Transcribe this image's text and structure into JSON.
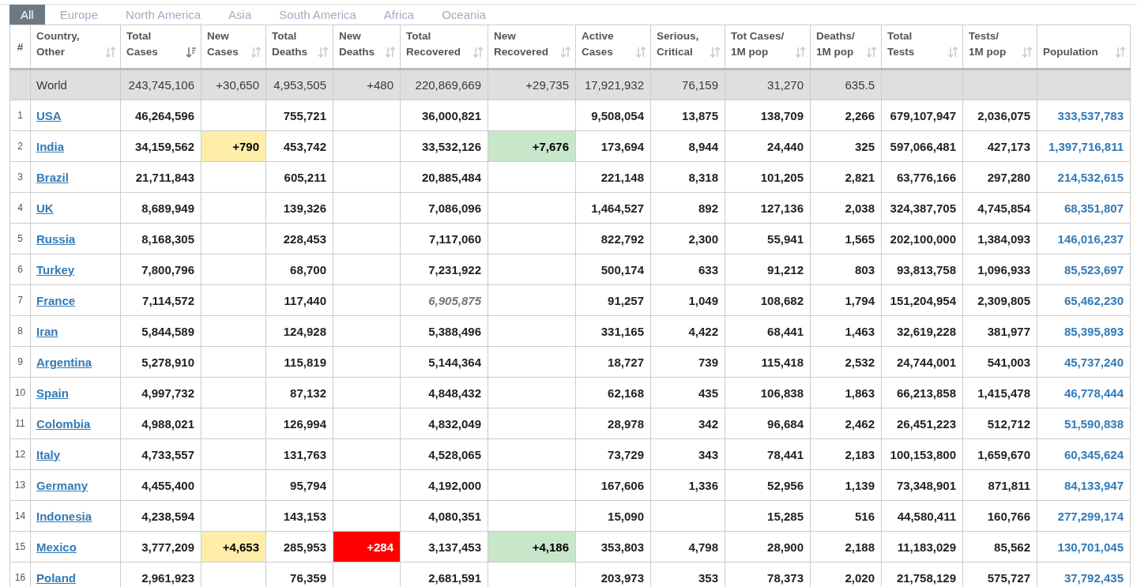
{
  "tabs": [
    {
      "label": "All",
      "selected": true
    },
    {
      "label": "Europe",
      "selected": false
    },
    {
      "label": "North America",
      "selected": false
    },
    {
      "label": "Asia",
      "selected": false
    },
    {
      "label": "South America",
      "selected": false
    },
    {
      "label": "Africa",
      "selected": false
    },
    {
      "label": "Oceania",
      "selected": false
    }
  ],
  "table": {
    "rank_header": "#",
    "country_header": {
      "label": [
        "Country,",
        "Other"
      ],
      "sorted": false
    },
    "columns": [
      {
        "label": [
          "Total",
          "Cases"
        ],
        "kind": "number",
        "sorted": true
      },
      {
        "label": [
          "New",
          "Cases"
        ],
        "kind": "new_cases",
        "sorted": false,
        "color": "#ffeeaa"
      },
      {
        "label": [
          "Total",
          "Deaths"
        ],
        "kind": "number",
        "sorted": false
      },
      {
        "label": [
          "New",
          "Deaths"
        ],
        "kind": "new_deaths",
        "sorted": false,
        "color": "#ff0000"
      },
      {
        "label": [
          "Total",
          "Recovered"
        ],
        "kind": "number",
        "sorted": false
      },
      {
        "label": [
          "New",
          "Recovered"
        ],
        "kind": "new_recovered",
        "sorted": false,
        "color": "#c8e6c9"
      },
      {
        "label": [
          "Active",
          "Cases"
        ],
        "kind": "number",
        "sorted": false
      },
      {
        "label": [
          "Serious,",
          "Critical"
        ],
        "kind": "number",
        "sorted": false
      },
      {
        "label": [
          "Tot Cases/",
          "1M pop"
        ],
        "kind": "number",
        "sorted": false
      },
      {
        "label": [
          "Deaths/",
          "1M pop"
        ],
        "kind": "number",
        "sorted": false
      },
      {
        "label": [
          "Total",
          "Tests"
        ],
        "kind": "number",
        "sorted": false
      },
      {
        "label": [
          "Tests/",
          "1M pop"
        ],
        "kind": "number",
        "sorted": false
      },
      {
        "label": [
          "Population"
        ],
        "kind": "population",
        "sorted": false
      }
    ],
    "world": {
      "country": "World",
      "cells": [
        "243,745,106",
        "+30,650",
        "4,953,505",
        "+480",
        "220,869,669",
        "+29,735",
        "17,921,932",
        "76,159",
        "31,270",
        "635.5",
        null,
        null,
        null
      ]
    },
    "rows": [
      {
        "rank": "1",
        "country": "USA",
        "recovered_estimated": false,
        "cells": [
          "46,264,596",
          null,
          "755,721",
          null,
          "36,000,821",
          null,
          "9,508,054",
          "13,875",
          "138,709",
          "2,266",
          "679,107,947",
          "2,036,075",
          "333,537,783"
        ]
      },
      {
        "rank": "2",
        "country": "India",
        "recovered_estimated": false,
        "cells": [
          "34,159,562",
          "+790",
          "453,742",
          null,
          "33,532,126",
          "+7,676",
          "173,694",
          "8,944",
          "24,440",
          "325",
          "597,066,481",
          "427,173",
          "1,397,716,811"
        ]
      },
      {
        "rank": "3",
        "country": "Brazil",
        "recovered_estimated": false,
        "cells": [
          "21,711,843",
          null,
          "605,211",
          null,
          "20,885,484",
          null,
          "221,148",
          "8,318",
          "101,205",
          "2,821",
          "63,776,166",
          "297,280",
          "214,532,615"
        ]
      },
      {
        "rank": "4",
        "country": "UK",
        "recovered_estimated": false,
        "cells": [
          "8,689,949",
          null,
          "139,326",
          null,
          "7,086,096",
          null,
          "1,464,527",
          "892",
          "127,136",
          "2,038",
          "324,387,705",
          "4,745,854",
          "68,351,807"
        ]
      },
      {
        "rank": "5",
        "country": "Russia",
        "recovered_estimated": false,
        "cells": [
          "8,168,305",
          null,
          "228,453",
          null,
          "7,117,060",
          null,
          "822,792",
          "2,300",
          "55,941",
          "1,565",
          "202,100,000",
          "1,384,093",
          "146,016,237"
        ]
      },
      {
        "rank": "6",
        "country": "Turkey",
        "recovered_estimated": false,
        "cells": [
          "7,800,796",
          null,
          "68,700",
          null,
          "7,231,922",
          null,
          "500,174",
          "633",
          "91,212",
          "803",
          "93,813,758",
          "1,096,933",
          "85,523,697"
        ]
      },
      {
        "rank": "7",
        "country": "France",
        "recovered_estimated": true,
        "cells": [
          "7,114,572",
          null,
          "117,440",
          null,
          "6,905,875",
          null,
          "91,257",
          "1,049",
          "108,682",
          "1,794",
          "151,204,954",
          "2,309,805",
          "65,462,230"
        ]
      },
      {
        "rank": "8",
        "country": "Iran",
        "recovered_estimated": false,
        "cells": [
          "5,844,589",
          null,
          "124,928",
          null,
          "5,388,496",
          null,
          "331,165",
          "4,422",
          "68,441",
          "1,463",
          "32,619,228",
          "381,977",
          "85,395,893"
        ]
      },
      {
        "rank": "9",
        "country": "Argentina",
        "recovered_estimated": false,
        "cells": [
          "5,278,910",
          null,
          "115,819",
          null,
          "5,144,364",
          null,
          "18,727",
          "739",
          "115,418",
          "2,532",
          "24,744,001",
          "541,003",
          "45,737,240"
        ]
      },
      {
        "rank": "10",
        "country": "Spain",
        "recovered_estimated": false,
        "cells": [
          "4,997,732",
          null,
          "87,132",
          null,
          "4,848,432",
          null,
          "62,168",
          "435",
          "106,838",
          "1,863",
          "66,213,858",
          "1,415,478",
          "46,778,444"
        ]
      },
      {
        "rank": "11",
        "country": "Colombia",
        "recovered_estimated": false,
        "cells": [
          "4,988,021",
          null,
          "126,994",
          null,
          "4,832,049",
          null,
          "28,978",
          "342",
          "96,684",
          "2,462",
          "26,451,223",
          "512,712",
          "51,590,838"
        ]
      },
      {
        "rank": "12",
        "country": "Italy",
        "recovered_estimated": false,
        "cells": [
          "4,733,557",
          null,
          "131,763",
          null,
          "4,528,065",
          null,
          "73,729",
          "343",
          "78,441",
          "2,183",
          "100,153,800",
          "1,659,670",
          "60,345,624"
        ]
      },
      {
        "rank": "13",
        "country": "Germany",
        "recovered_estimated": false,
        "cells": [
          "4,455,400",
          null,
          "95,794",
          null,
          "4,192,000",
          null,
          "167,606",
          "1,336",
          "52,956",
          "1,139",
          "73,348,901",
          "871,811",
          "84,133,947"
        ]
      },
      {
        "rank": "14",
        "country": "Indonesia",
        "recovered_estimated": false,
        "cells": [
          "4,238,594",
          null,
          "143,153",
          null,
          "4,080,351",
          null,
          "15,090",
          null,
          "15,285",
          "516",
          "44,580,411",
          "160,766",
          "277,299,174"
        ]
      },
      {
        "rank": "15",
        "country": "Mexico",
        "recovered_estimated": false,
        "cells": [
          "3,777,209",
          "+4,653",
          "285,953",
          "+284",
          "3,137,453",
          "+4,186",
          "353,803",
          "4,798",
          "28,900",
          "2,188",
          "11,183,029",
          "85,562",
          "130,701,045"
        ]
      },
      {
        "rank": "16",
        "country": "Poland",
        "recovered_estimated": false,
        "cells": [
          "2,961,923",
          null,
          "76,359",
          null,
          "2,681,591",
          null,
          "203,973",
          "353",
          "78,373",
          "2,020",
          "21,758,129",
          "575,727",
          "37,792,435"
        ]
      }
    ]
  }
}
